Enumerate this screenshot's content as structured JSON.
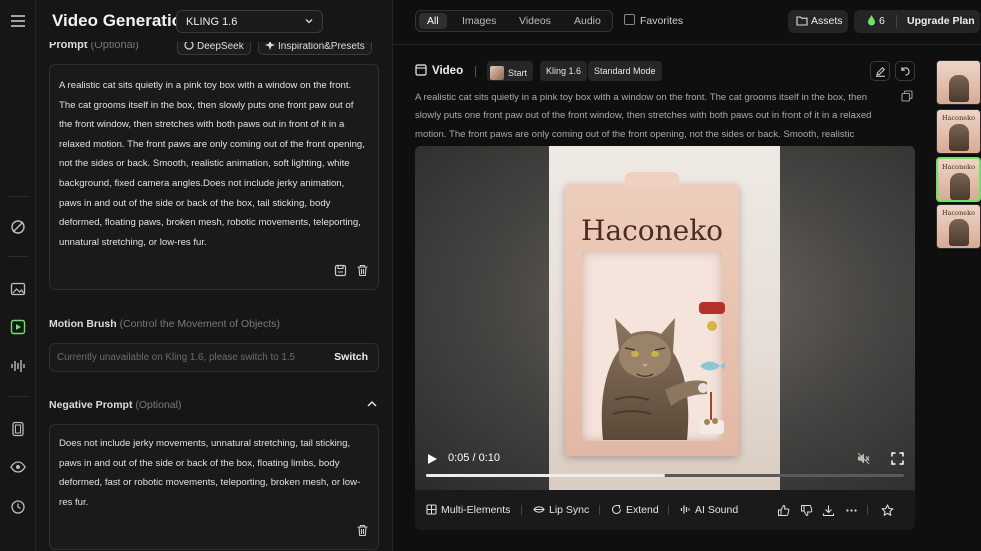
{
  "header": {
    "title": "Video Generation",
    "model": "KLING 1.6",
    "filter_tabs": [
      "All",
      "Images",
      "Videos",
      "Audio"
    ],
    "selected_tab": "All",
    "favorites_label": "Favorites",
    "assets_label": "Assets",
    "credits": "6",
    "upgrade_label": "Upgrade Plan"
  },
  "prompt": {
    "label": "Prompt",
    "optional": "(Optional)",
    "deepseek_label": "DeepSeek",
    "inspiration_label": "Inspiration&Presets",
    "text": "A realistic cat sits quietly in a pink toy box with a window on the front. The cat grooms itself in the box, then slowly puts one front paw out of the front window, then stretches with both paws out in front of it in a relaxed motion. The front paws are only coming out of the front opening, not the sides or back. Smooth, realistic animation, soft lighting, white background, fixed camera angles.Does not include jerky animation, paws in and out of the side or back of the box, tail sticking, body deformed, floating paws, broken mesh, robotic movements, teleporting, unnatural stretching, or low-res fur."
  },
  "motion_brush": {
    "label": "Motion Brush",
    "hint": "(Control the Movement of Objects)",
    "placeholder": "Currently unavailable on Kling 1.6, please switch to 1.5",
    "switch_label": "Switch"
  },
  "negative_prompt": {
    "label": "Negative Prompt",
    "optional": "(Optional)",
    "text": "Does not include jerky movements, unnatural stretching, tail sticking, paws in and out of the side or back of the box, floating limbs, body deformed, fast or robotic movements, teleporting, broken mesh, or low-res fur."
  },
  "video_panel": {
    "label": "Video",
    "chips": [
      "Start",
      "Kling 1.6",
      "Standard Mode"
    ],
    "description": "A realistic cat sits quietly in a pink toy box with a window on the front. The cat grooms itself in the box, then slowly puts one front paw out of the front window, then stretches with both paws out in front of it in a relaxed motion. The front paws are only coming out of the front opening, not the sides or back. Smooth, realistic",
    "box_brand": "Haconeko",
    "time": "0:05 / 0:10",
    "progress": 0.5
  },
  "toolbar": {
    "multi_elements": "Multi-Elements",
    "lip_sync": "Lip Sync",
    "extend": "Extend",
    "ai_sound": "AI Sound"
  },
  "thumbnails": [
    {
      "brand": ""
    },
    {
      "brand": "Haconeko"
    },
    {
      "brand": "Haconeko"
    },
    {
      "brand": "Haconeko"
    }
  ],
  "colors": {
    "accent": "#6fe06a",
    "background": "#0f0f10",
    "panel": "#161617"
  }
}
